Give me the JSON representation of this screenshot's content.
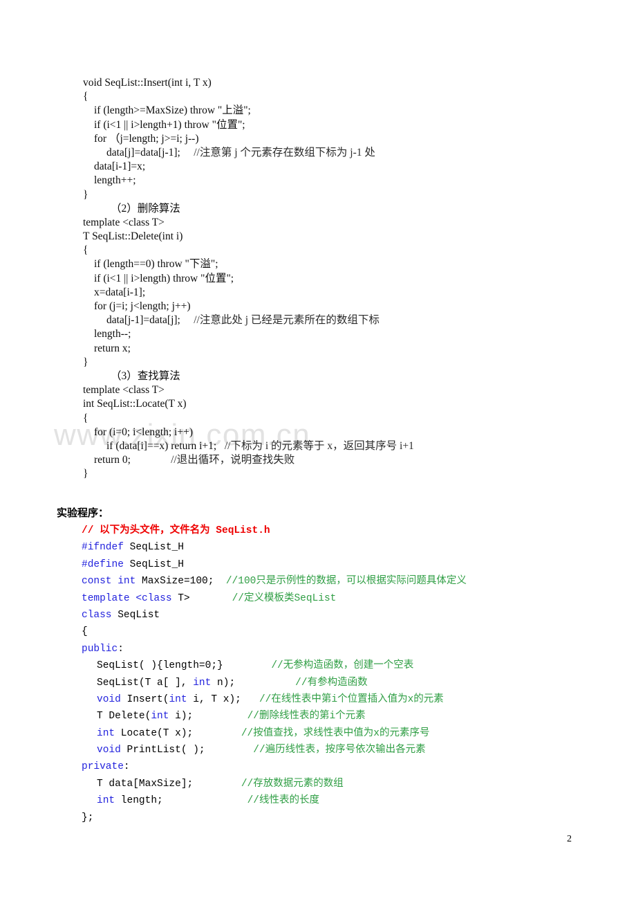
{
  "watermark": {
    "text": "www.zixin.com.cn"
  },
  "page_number": "2",
  "section_heading": "实验程序：",
  "serif_code": {
    "lines": [
      {
        "indent": 0,
        "text": "void SeqList::Insert(int i, T x)"
      },
      {
        "indent": 0,
        "text": "{"
      },
      {
        "indent": 1,
        "text": "if (length>=MaxSize) throw \"上溢\";"
      },
      {
        "indent": 1,
        "text": "if (i<1 || i>length+1) throw \"位置\";"
      },
      {
        "indent": 1,
        "text": "for （j=length; j>=i; j--)"
      },
      {
        "indent": 2,
        "text": "data[j]=data[j-1];",
        "comment": "//注意第 j 个元素存在数组下标为 j-1 处",
        "comment_gap": 5
      },
      {
        "indent": 1,
        "text": "data[i-1]=x;"
      },
      {
        "indent": 1,
        "text": "length++;"
      },
      {
        "indent": 0,
        "text": "}"
      },
      {
        "indent": 3,
        "text": "（2）删除算法"
      },
      {
        "indent": 0,
        "text": "template <class T>"
      },
      {
        "indent": 0,
        "text": "T SeqList::Delete(int i)"
      },
      {
        "indent": 0,
        "text": "{"
      },
      {
        "indent": 1,
        "text": "if (length==0) throw \"下溢\";"
      },
      {
        "indent": 1,
        "text": "if (i<1 || i>length) throw \"位置\";"
      },
      {
        "indent": 1,
        "text": "x=data[i-1];"
      },
      {
        "indent": 1,
        "text": "for (j=i; j<length; j++)"
      },
      {
        "indent": 2,
        "text": "data[j-1]=data[j];",
        "comment": "//注意此处 j 已经是元素所在的数组下标",
        "comment_gap": 5
      },
      {
        "indent": 1,
        "text": "length--;"
      },
      {
        "indent": 1,
        "text": "return x;"
      },
      {
        "indent": 0,
        "text": "}"
      },
      {
        "indent": 3,
        "text": "（3）查找算法"
      },
      {
        "indent": 0,
        "text": "template <class T>"
      },
      {
        "indent": 0,
        "text": "int SeqList::Locate(T x)"
      },
      {
        "indent": 0,
        "text": "{"
      },
      {
        "indent": 1,
        "text": "for (i=0; i<length; i++)"
      },
      {
        "indent": 2,
        "text": "if (data[i]==x) return i+1;",
        "comment": "//下标为 i 的元素等于 x，返回其序号 i+1",
        "comment_gap": 3
      },
      {
        "indent": 1,
        "text": "return 0;",
        "comment": "//退出循环，说明查找失败",
        "comment_gap": 15
      },
      {
        "indent": 0,
        "text": "}"
      }
    ]
  },
  "mono_code": {
    "lines": [
      {
        "indent": 1,
        "style": "header",
        "text": "// 以下为头文件，文件名为 SeqList.h"
      },
      {
        "indent": 1,
        "keyword": "#ifndef",
        "text": " SeqList_H"
      },
      {
        "indent": 1,
        "keyword": "#define",
        "text": " SeqList_H"
      },
      {
        "indent": 1,
        "keyword": "const int",
        "text": " MaxSize=100;",
        "comment": "//100只是示例性的数据，可以根据实际问题具体定义",
        "comment_gap": 2
      },
      {
        "indent": 1,
        "keyword": "template <class",
        "text": " T>",
        "keyword2": "",
        "comment": "//定义模板类SeqList",
        "comment_gap": 7
      },
      {
        "indent": 1,
        "keyword": "class",
        "text": " SeqList"
      },
      {
        "indent": 1,
        "text": "{"
      },
      {
        "indent": 1,
        "keyword": "public",
        "text": ":"
      },
      {
        "indent": 2,
        "text": "SeqList( ){length=0;}",
        "comment": "//无参构造函数，创建一个空表",
        "comment_gap": 8
      },
      {
        "indent": 2,
        "text": "SeqList(T a[ ], ",
        "keyword_mid": "int",
        "text_after": " n);",
        "comment": "//有参构造函数",
        "comment_gap": 10
      },
      {
        "indent": 2,
        "keyword": "void",
        "text": " Insert(",
        "keyword_mid": "int",
        "text_after": " i, T x);",
        "comment": "//在线性表中第i个位置插入值为x的元素",
        "comment_gap": 3
      },
      {
        "indent": 2,
        "text": "T Delete(",
        "keyword_mid": "int",
        "text_after": " i);",
        "comment": "//删除线性表的第i个元素",
        "comment_gap": 9
      },
      {
        "indent": 2,
        "keyword": "int",
        "text": " Locate(T x);",
        "comment": "//按值查找，求线性表中值为x的元素序号",
        "comment_gap": 8
      },
      {
        "indent": 2,
        "keyword": "void",
        "text": " PrintList( );",
        "comment": "//遍历线性表，按序号依次输出各元素",
        "comment_gap": 8
      },
      {
        "indent": 1,
        "keyword": "private",
        "text": ":"
      },
      {
        "indent": 2,
        "text": "T data[MaxSize];",
        "comment": "//存放数据元素的数组",
        "comment_gap": 8
      },
      {
        "indent": 2,
        "keyword": "int",
        "text": " length;",
        "comment": "//线性表的长度",
        "comment_gap": 14
      },
      {
        "indent": 1,
        "text": "};"
      }
    ]
  },
  "colors": {
    "keyword": "#2222dd",
    "comment": "#2f9e44",
    "header_comment": "#ee0000",
    "watermark": "#e2e2e2",
    "body_text": "#000000"
  }
}
